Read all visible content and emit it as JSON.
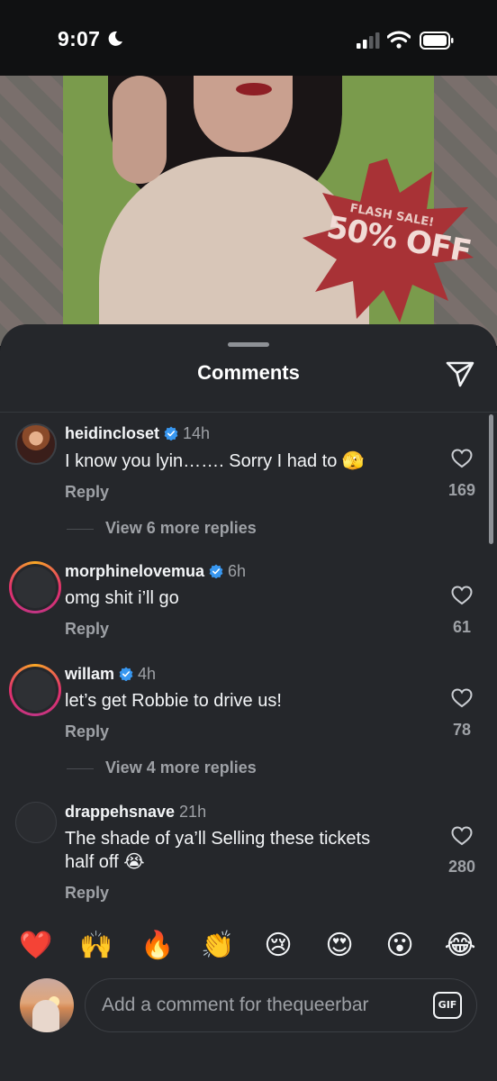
{
  "status_bar": {
    "time": "9:07"
  },
  "post_image": {
    "flash_sale_text": "FLASH SALE!",
    "discount_text": "50% OFF"
  },
  "sheet": {
    "title": "Comments"
  },
  "comments": [
    {
      "username": "heidincloset",
      "verified": true,
      "time": "14h",
      "text": "I know you lyin……. Sorry I had to 🫣",
      "reply_label": "Reply",
      "likes": "169",
      "view_replies": "View 6 more replies"
    },
    {
      "username": "morphinelovemua",
      "verified": true,
      "time": "6h",
      "text": "omg shit i’ll go",
      "reply_label": "Reply",
      "likes": "61"
    },
    {
      "username": "willam",
      "verified": true,
      "time": "4h",
      "text": "let’s get Robbie to drive us!",
      "reply_label": "Reply",
      "likes": "78",
      "view_replies": "View 4 more replies"
    },
    {
      "username": "drappehsnave",
      "verified": false,
      "time": "21h",
      "text_line1": "The shade of ya’ll Selling these tickets",
      "text_line2": "half off 😭",
      "reply_label": "Reply",
      "likes": "280"
    }
  ],
  "emoji_bar": [
    "❤️",
    "🙌",
    "🔥",
    "👏",
    "😢",
    "😍",
    "😮",
    "😂"
  ],
  "composer": {
    "placeholder": "Add a comment for thequeerbar",
    "gif_label": "GIF"
  },
  "colors": {
    "sheet_background": "#25272b",
    "verified_blue": "#3897f0",
    "muted_text": "#9ea1a6"
  },
  "icons": [
    "moon-icon",
    "signal-icon",
    "wifi-icon",
    "battery-icon",
    "share-icon",
    "verified-icon",
    "heart-icon",
    "gif-icon"
  ]
}
